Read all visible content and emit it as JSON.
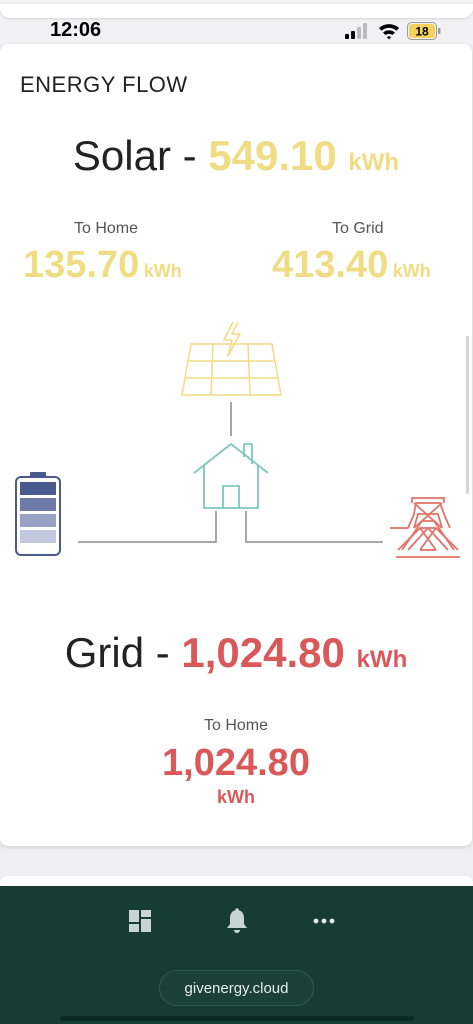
{
  "status_bar": {
    "time": "12:06",
    "battery_level": "18"
  },
  "card": {
    "title": "ENERGY FLOW",
    "solar": {
      "label": "Solar - ",
      "value": "549.10",
      "unit": "kWh",
      "to_home": {
        "label": "To Home",
        "value": "135.70",
        "unit": "kWh"
      },
      "to_grid": {
        "label": "To Grid",
        "value": "413.40",
        "unit": "kWh"
      }
    },
    "grid": {
      "label": "Grid - ",
      "value": "1,024.80",
      "unit": "kWh",
      "to_home": {
        "label": "To Home",
        "value": "1,024.80",
        "unit": "kWh"
      }
    }
  },
  "diagram": {
    "icons": [
      "solar-panel-icon",
      "house-icon",
      "battery-icon",
      "grid-tower-icon"
    ],
    "colors": {
      "solar": "#f0dc82",
      "house": "#7ec7bd",
      "battery": "#4a5a8f",
      "tower": "#e2736a",
      "lines": "#8a8a8a"
    }
  },
  "bottom_nav": {
    "items": [
      "dashboard-icon",
      "notifications-icon",
      "more-icon"
    ],
    "url": "givenergy.cloud"
  },
  "colors": {
    "solar_yellow": "#f0dc82",
    "grid_red": "#d9595a",
    "nav_bg": "#163c34"
  }
}
